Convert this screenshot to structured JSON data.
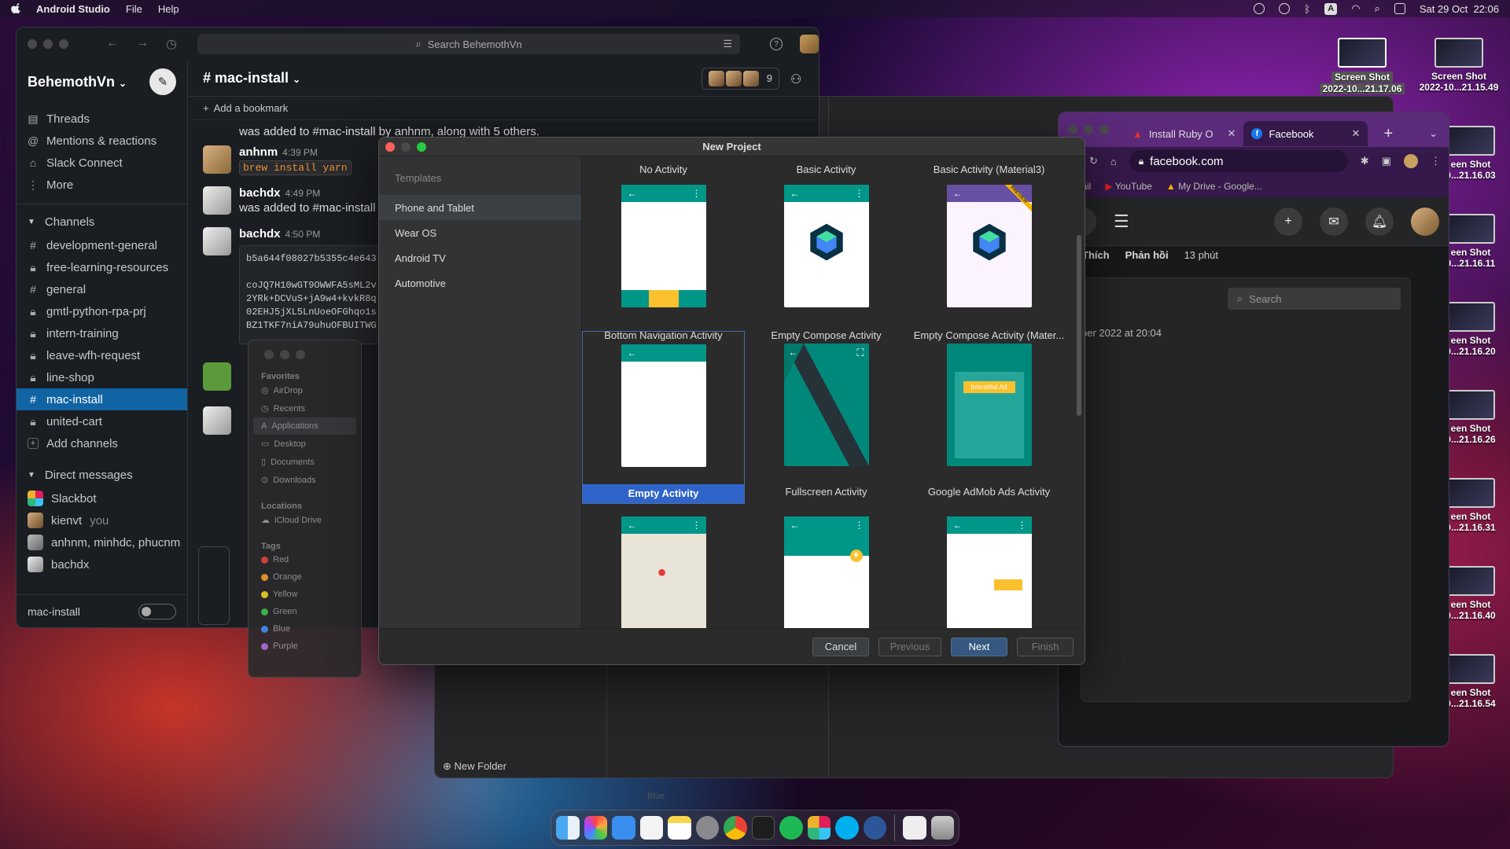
{
  "menubar": {
    "app_name": "Android Studio",
    "menus": [
      "File",
      "Help"
    ],
    "datetime": "Sat 29 Oct  22:06",
    "input_indicator": "A"
  },
  "slack": {
    "search_placeholder": "Search BehemothVn",
    "workspace": "BehemothVn",
    "nav": [
      {
        "label": "Threads",
        "icon": "threads-icon"
      },
      {
        "label": "Mentions & reactions",
        "icon": "at-icon"
      },
      {
        "label": "Slack Connect",
        "icon": "connect-icon"
      },
      {
        "label": "More",
        "icon": "more-icon"
      }
    ],
    "channels_label": "Channels",
    "channels": [
      {
        "label": "development-general",
        "prefix": "#"
      },
      {
        "label": "free-learning-resources",
        "prefix": "lock"
      },
      {
        "label": "general",
        "prefix": "#"
      },
      {
        "label": "gmtl-python-rpa-prj",
        "prefix": "lock"
      },
      {
        "label": "intern-training",
        "prefix": "lock"
      },
      {
        "label": "leave-wfh-request",
        "prefix": "lock"
      },
      {
        "label": "line-shop",
        "prefix": "lock"
      },
      {
        "label": "mac-install",
        "prefix": "#",
        "active": true
      },
      {
        "label": "united-cart",
        "prefix": "lock"
      }
    ],
    "add_channels": "Add channels",
    "dm_label": "Direct messages",
    "dms": [
      {
        "label": "Slackbot",
        "suffix": ""
      },
      {
        "label": "kienvt",
        "suffix": "you"
      },
      {
        "label": "anhnm, minhdc, phucnm",
        "suffix": ""
      },
      {
        "label": "bachdx",
        "suffix": ""
      }
    ],
    "footer_channel": "mac-install",
    "channel_title": "mac-install",
    "member_count": "9",
    "bookmark": "Add a bookmark",
    "messages": [
      {
        "text": "was added to #mac-install by anhnm, along with 5 others."
      },
      {
        "name": "anhnm",
        "time": "4:39 PM",
        "code": "brew install yarn"
      },
      {
        "name": "bachdx",
        "time": "4:49 PM",
        "text": "was added to #mac-install"
      },
      {
        "name": "bachdx",
        "time": "4:50 PM",
        "code_block": "b5a644f08027b5355c4e643\n\ncoJQ7H10wGT9OWWFA5sML2v\n2YRk+DCVuS+jA9w4+kvkR8q\n02EHJ5jXL5LnUoeOFGhqo1s\nBZ1TKF7niA79uhuOFBUITWG"
      }
    ]
  },
  "finder": {
    "favorites": "Favorites",
    "fav_items": [
      "AirDrop",
      "Recents",
      "Applications",
      "Desktop",
      "Documents",
      "Downloads"
    ],
    "locations": "Locations",
    "loc_items": [
      "iCloud Drive"
    ],
    "tags": "Tags",
    "tag_items": [
      {
        "label": "Red",
        "color": "#e0443e"
      },
      {
        "label": "Orange",
        "color": "#f39a2a"
      },
      {
        "label": "Yellow",
        "color": "#f3d02a"
      },
      {
        "label": "Green",
        "color": "#3fbf4f"
      },
      {
        "label": "Blue",
        "color": "#3a8ef0"
      },
      {
        "label": "Purple",
        "color": "#a46ad8"
      }
    ],
    "new_folder": "New Folder",
    "bg_tag_blue": "Blue",
    "bg_tag_purple": "Purple"
  },
  "chrome": {
    "tabs": [
      {
        "label": "Install Ruby O",
        "favicon": "ruby-icon"
      },
      {
        "label": "Facebook",
        "favicon": "facebook-icon",
        "active": true
      }
    ],
    "url": "facebook.com",
    "bookmarks": [
      "Gmail",
      "YouTube",
      "My Drive - Google..."
    ],
    "fb_like": "Thích",
    "fb_reply": "Phản hồi",
    "fb_time": "13 phút",
    "fb_search_placeholder": "Search",
    "fb_date": "ber 2022 at 20:04"
  },
  "desktop_shots": [
    {
      "l1": "Screen Shot",
      "l2": "2022-10...21.17.06",
      "selected": true
    },
    {
      "l1": "Screen Shot",
      "l2": "2022-10...21.15.49"
    },
    {
      "l1": "een Shot",
      "l2": "0...21.16.03"
    },
    {
      "l1": "een Shot",
      "l2": "0...21.16.11"
    },
    {
      "l1": "een Shot",
      "l2": "0...21.16.20"
    },
    {
      "l1": "een Shot",
      "l2": "0...21.16.26"
    },
    {
      "l1": "een Shot",
      "l2": "0...21.16.31"
    },
    {
      "l1": "een Shot",
      "l2": "0...21.16.40"
    },
    {
      "l1": "een Shot",
      "l2": "0...21.16.54"
    }
  ],
  "dialog": {
    "title": "New Project",
    "templates_header": "Templates",
    "categories": [
      {
        "label": "Phone and Tablet",
        "selected": true
      },
      {
        "label": "Wear OS"
      },
      {
        "label": "Android TV"
      },
      {
        "label": "Automotive"
      }
    ],
    "row0": [
      "No Activity",
      "Basic Activity",
      "Basic Activity (Material3)"
    ],
    "row1": [
      "Bottom Navigation Activity",
      "Empty Compose Activity",
      "Empty Compose Activity (Mater..."
    ],
    "row2": [
      "Empty Activity",
      "Fullscreen Activity",
      "Google AdMob Ads Activity"
    ],
    "preview_badge": "PREVIEW",
    "interstitial": "Interstitial Ad",
    "buttons": {
      "cancel": "Cancel",
      "previous": "Previous",
      "next": "Next",
      "finish": "Finish"
    }
  },
  "dock": [
    "finder-icon",
    "launchpad-icon",
    "mail-icon",
    "reminders-icon",
    "notes-icon",
    "system-settings-icon",
    "chrome-icon",
    "terminal-icon",
    "spotify-icon",
    "slack-icon",
    "skype-icon",
    "word-icon",
    "document-icon",
    "trash-icon"
  ]
}
